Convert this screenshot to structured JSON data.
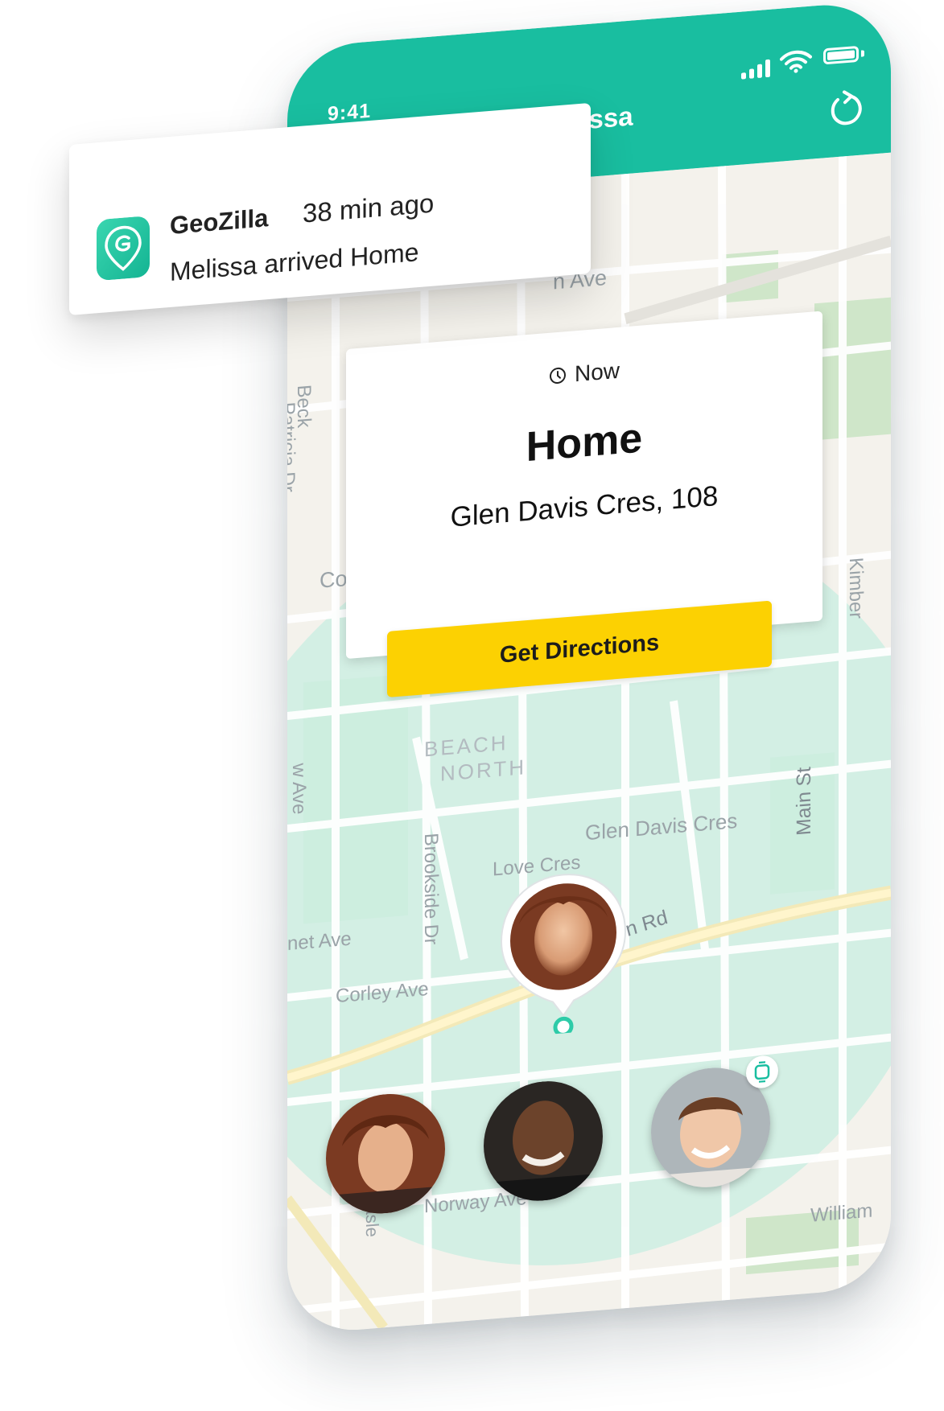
{
  "status_bar": {
    "time": "9:41"
  },
  "header": {
    "title": "Melissa"
  },
  "notification": {
    "app_name": "GeoZilla",
    "time_ago": "38 min ago",
    "message": "Melissa arrived Home"
  },
  "place_card": {
    "time_label": "Now",
    "name": "Home",
    "address": "Glen Davis Cres, 108",
    "directions_button": "Get Directions"
  },
  "map_labels": {
    "ave_top": "n Ave",
    "beck": "Beck",
    "patricia_dr": "Patricia Dr",
    "co": "Co",
    "kimber": "Kimber",
    "beach": "BEACH",
    "north": "NORTH",
    "ave_left": "w Ave",
    "main_st": "Main St",
    "glen_davis": "Glen Davis Cres",
    "love_cres": "Love Cres",
    "brookside": "Brookside Dr",
    "net_ave": "net Ave",
    "kingston": "Kingston Rd",
    "corley": "Corley Ave",
    "hasle": "Hasle",
    "norway": "Norway Ave",
    "william": "William"
  },
  "colors": {
    "brand_teal": "#19bea0",
    "button_yellow": "#fcd102",
    "geofence": "#cdeee3"
  },
  "icons": [
    "cellular-signal-icon",
    "wifi-icon",
    "battery-icon",
    "refresh-icon",
    "clock-icon",
    "geozilla-logo-icon",
    "smartwatch-icon"
  ]
}
